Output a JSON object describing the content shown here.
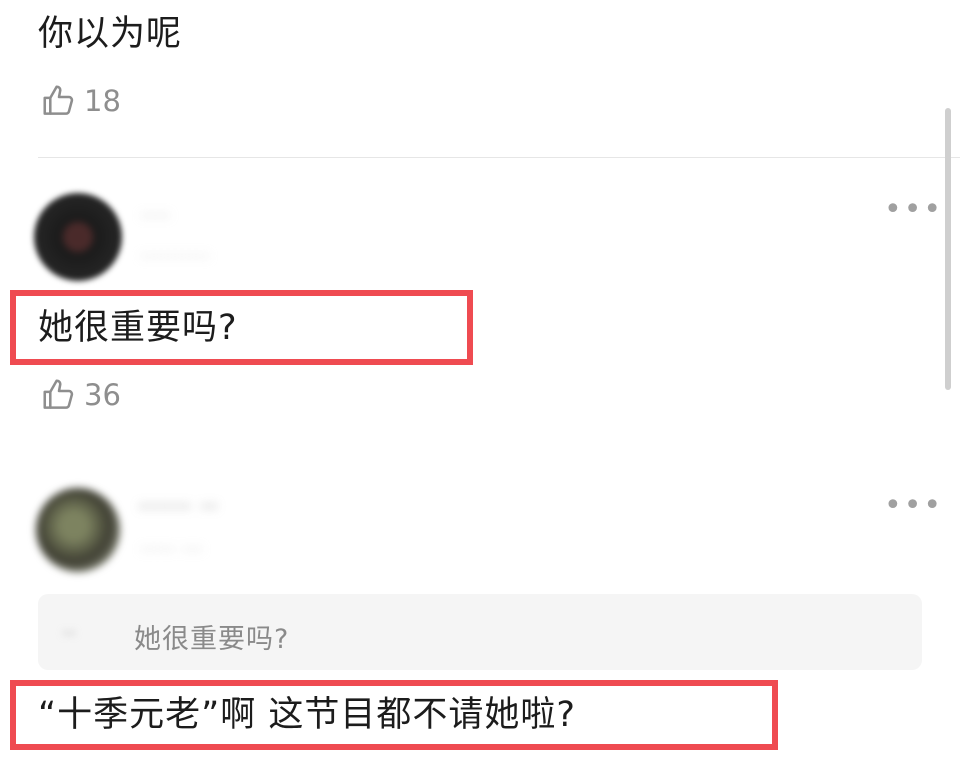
{
  "comments": [
    {
      "text": "你以为呢",
      "likes": "18"
    },
    {
      "author": "····",
      "time": "··········",
      "text": "她很重要吗?",
      "likes": "36",
      "more": "•••"
    },
    {
      "author": "······ ··",
      "time": "····· ···",
      "quote_author": "··",
      "quote_text": "她很重要吗?",
      "text": "“十季元老”啊 这节目都不请她啦?",
      "more": "•••"
    }
  ],
  "colors": {
    "highlight": "#ef4b51",
    "muted": "#8e8e8e"
  },
  "icons": {
    "like": "thumbs-up-icon",
    "more": "more-icon"
  }
}
